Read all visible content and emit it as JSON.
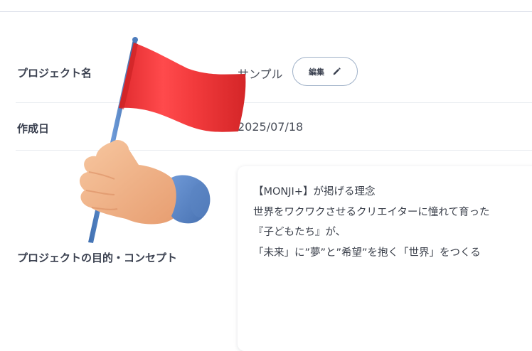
{
  "project": {
    "name_label": "プロジェクト名",
    "name_value": "サンプル",
    "edit_label": "編集",
    "created_label": "作成日",
    "created_value": "2025/07/18",
    "concept_label": "プロジェクトの目的・コンセプト",
    "concept_lines": [
      "【MONJI+】が掲げる理念",
      "世界をワクワクさせるクリエイターに憧れて育った",
      "『子どもたち』が、",
      "「未来」に”夢”と”希望”を抱く「世界」をつくる"
    ]
  },
  "icons": {
    "edit": "pencil-icon",
    "decoration": "raised-flag-hand-icon"
  },
  "colors": {
    "flag": "#f23a3c",
    "sleeve": "#5b86c6",
    "skin": "#f2b98e",
    "button_border": "#9fb1c8"
  }
}
